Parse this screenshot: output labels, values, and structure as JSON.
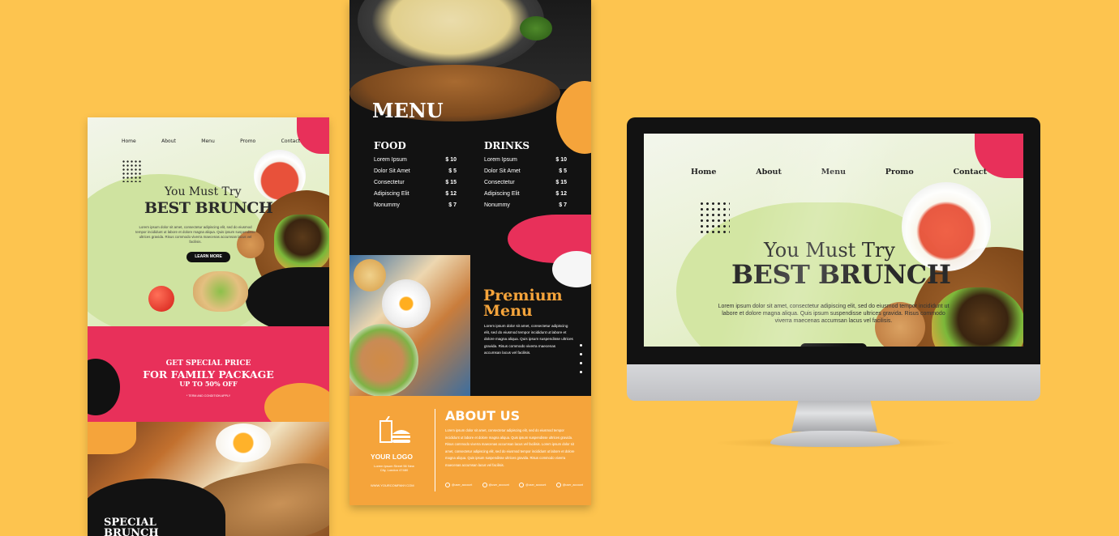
{
  "colors": {
    "background": "#FDC44F",
    "accent_pink": "#E8305A",
    "accent_orange": "#F5A43B",
    "dark": "#121212",
    "hero_green": "#E4EFC7"
  },
  "mobile": {
    "nav": [
      "Home",
      "About",
      "Menu",
      "Promo",
      "Contact"
    ],
    "hero_sub": "You Must Try",
    "hero_title": "BEST BRUNCH",
    "hero_text": "Lorem ipsum dolor sit amet, consectetur adipiscing elit, sed do eiusmod tempor incididunt ut labore et dolore magna aliqua. Quis ipsum suspendisse ultrices gravida. Risus commodo viverra maecenas accumsan lacus vel facilisis.",
    "cta": "LEARN MORE",
    "promo_line1": "GET SPECIAL PRICE",
    "promo_line2": "FOR FAMILY PACKAGE",
    "promo_line3": "UP TO 50% OFF",
    "promo_terms": "* TERM AND CONDITION APPLY",
    "special_line1": "SPECIAL",
    "special_line2": "BRUNCH"
  },
  "menu": {
    "title": "MENU",
    "food_header": "FOOD",
    "drinks_header": "DRINKS",
    "food_items": [
      {
        "name": "Lorem Ipsum",
        "price": "$ 10"
      },
      {
        "name": "Dolor Sit Amet",
        "price": "$ 5"
      },
      {
        "name": "Consectetur",
        "price": "$ 15"
      },
      {
        "name": "Adipiscing Elit",
        "price": "$ 12"
      },
      {
        "name": "Nonummy",
        "price": "$ 7"
      }
    ],
    "drink_items": [
      {
        "name": "Lorem Ipsum",
        "price": "$ 10"
      },
      {
        "name": "Dolor Sit Amet",
        "price": "$ 5"
      },
      {
        "name": "Consectetur",
        "price": "$ 15"
      },
      {
        "name": "Adipiscing Elit",
        "price": "$ 12"
      },
      {
        "name": "Nonummy",
        "price": "$ 7"
      }
    ],
    "premium_line1": "Premium",
    "premium_line2": "Menu",
    "premium_text": "Lorem ipsum dolor sit amet, consectetur adipiscing elit, sed do eiusmod tempor incididunt ut labore et dolore magna aliqua. Quis ipsum suspendisse ultrices gravida. Risus commodo viverra maecenas accumsan lacus vel facilisis.",
    "logo_text": "YOUR LOGO",
    "address": "Lorem Ipsum Street 56 New City, London 47480",
    "website": "WWW.YOURCOMPANY.COM",
    "about_title": "ABOUT US",
    "about_text": "Lorem ipsum dolor sit amet, consectetur adipiscing elit, sed do eiusmod tempor incididunt ut labore et dolore magna aliqua. Quis ipsum suspendisse ultrices gravida. Risus commodo viverra maecenas accumsan lacus vel facilisis. Lorem ipsum dolor sit amet, consectetur adipiscing elit, sed do eiusmod tempor incididunt ut labore et dolore magna aliqua. Quis ipsum suspendisse ultrices gravida. Risus commodo viverra maecenas accumsan lacus vel facilisis.",
    "socials": [
      {
        "icon": "facebook-icon",
        "handle": "@user_account"
      },
      {
        "icon": "instagram-icon",
        "handle": "@user_account"
      },
      {
        "icon": "twitter-icon",
        "handle": "@user_account"
      },
      {
        "icon": "youtube-icon",
        "handle": "@user_account"
      }
    ]
  },
  "desktop": {
    "nav": [
      "Home",
      "About",
      "Menu",
      "Promo",
      "Contact"
    ],
    "hero_sub": "You Must Try",
    "hero_title": "BEST BRUNCH",
    "hero_text": "Lorem ipsum dolor sit amet, consectetur adipiscing elit, sed do eiusmod tempor incididunt ut labore et dolore magna aliqua. Quis ipsum suspendisse ultrices gravida. Risus commodo viverra maecenas accumsan lacus vel facilisis."
  }
}
